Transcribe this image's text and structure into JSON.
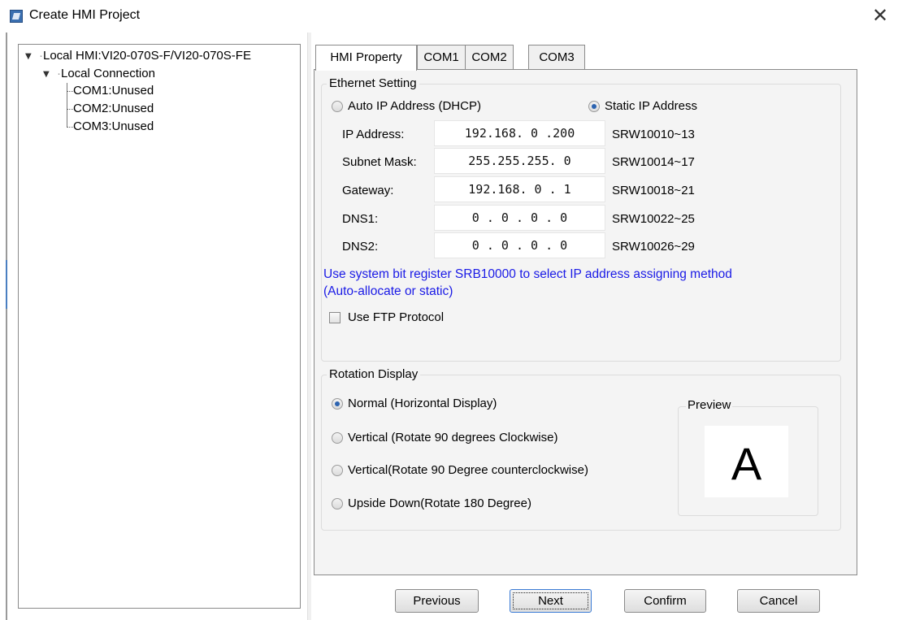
{
  "window": {
    "title": "Create HMI Project",
    "close_symbol": "✕"
  },
  "tree": {
    "root": "Local HMI:VI20-070S-F/VI20-070S-FE",
    "connection": "Local Connection",
    "items": [
      "COM1:Unused",
      "COM2:Unused",
      "COM3:Unused"
    ]
  },
  "tabs": [
    "HMI Property",
    "COM1",
    "COM2",
    "COM3"
  ],
  "ethernet": {
    "group_label": "Ethernet Setting",
    "auto_label": "Auto IP Address (DHCP)",
    "static_label": "Static IP Address",
    "selected": "static",
    "fields": [
      {
        "label": "IP Address:",
        "value": "192.168. 0 .200",
        "register": "SRW10010~13"
      },
      {
        "label": "Subnet Mask:",
        "value": "255.255.255. 0",
        "register": "SRW10014~17"
      },
      {
        "label": "Gateway:",
        "value": "192.168. 0 . 1",
        "register": "SRW10018~21"
      },
      {
        "label": "DNS1:",
        "value": "0 . 0 . 0 . 0",
        "register": "SRW10022~25"
      },
      {
        "label": "DNS2:",
        "value": "0 . 0 . 0 . 0",
        "register": "SRW10026~29"
      }
    ],
    "info_line1": "Use system bit register SRB10000 to select IP address assigning method",
    "info_line2": "(Auto-allocate or static)",
    "ftp_label": "Use FTP Protocol",
    "ftp_checked": false
  },
  "rotation": {
    "group_label": "Rotation Display",
    "options": [
      {
        "label": "Normal (Horizontal Display)",
        "checked": true
      },
      {
        "label": "Vertical (Rotate 90 degrees Clockwise)",
        "checked": false
      },
      {
        "label": "Vertical(Rotate 90 Degree counterclockwise)",
        "checked": false
      },
      {
        "label": "Upside Down(Rotate 180 Degree)",
        "checked": false
      }
    ],
    "preview_label": "Preview",
    "preview_char": "A"
  },
  "buttons": {
    "previous": "Previous",
    "next": "Next",
    "confirm": "Confirm",
    "cancel": "Cancel"
  },
  "colors": {
    "info_text": "#1a1ae6",
    "radio_dot": "#2c63b0",
    "focus_border": "#3a7bd5"
  }
}
